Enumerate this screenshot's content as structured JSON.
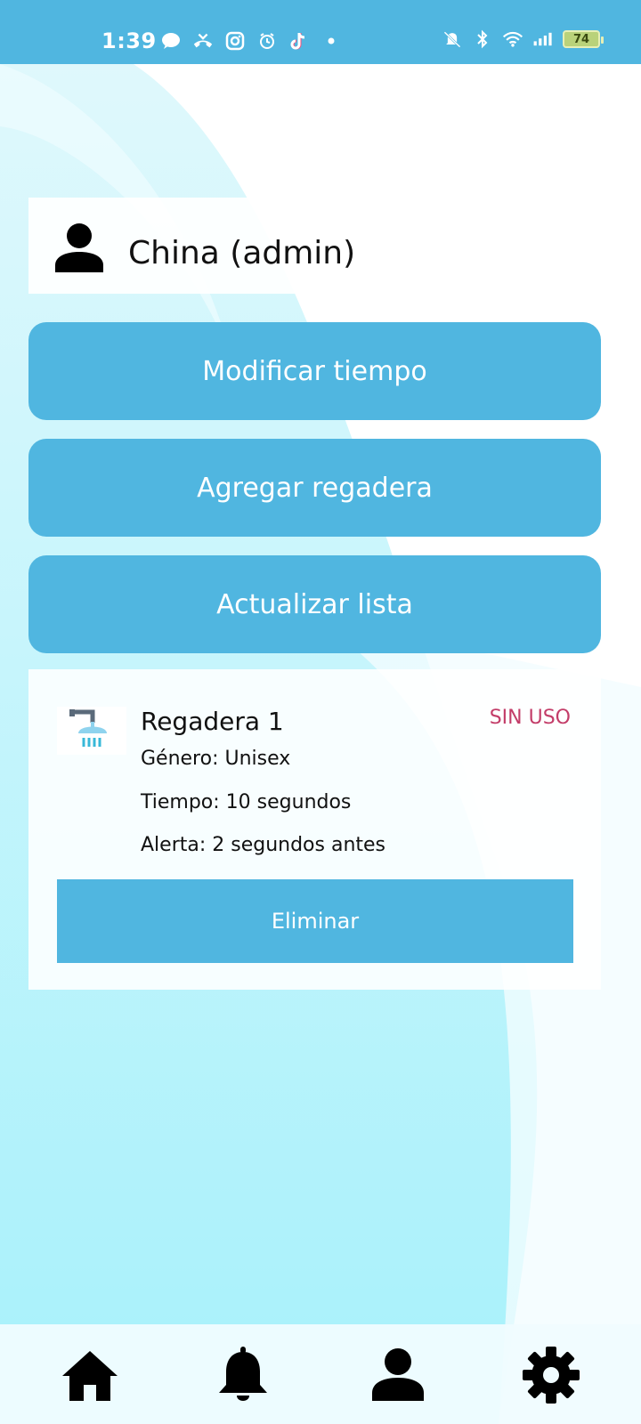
{
  "status_bar": {
    "time": "1:39",
    "battery": "74",
    "left_icons": [
      "message-icon",
      "missed-call-icon",
      "instagram-icon",
      "alarm-icon",
      "tiktok-icon",
      "dot-icon"
    ],
    "right_icons": [
      "mute-icon",
      "bluetooth-icon",
      "wifi-icon",
      "signal-icon",
      "battery-icon"
    ]
  },
  "header": {
    "user_name": "China (admin)",
    "icon": "user-icon"
  },
  "actions": {
    "modify_time": "Modificar tiempo",
    "add_shower": "Agregar regadera",
    "refresh_list": "Actualizar lista"
  },
  "showers": [
    {
      "name": "Regadera 1",
      "status": "SIN USO",
      "gender": "Género: Unisex",
      "time": "Tiempo: 10 segundos",
      "alert": "Alerta: 2 segundos antes",
      "delete_label": "Eliminar",
      "icon": "shower-icon"
    }
  ],
  "bottom_nav": {
    "items": [
      "home-icon",
      "bell-icon",
      "profile-icon",
      "settings-icon"
    ]
  },
  "colors": {
    "primary": "#50b6e0",
    "status_red": "#c33d69",
    "background_cyan": "#a8f2fb"
  }
}
